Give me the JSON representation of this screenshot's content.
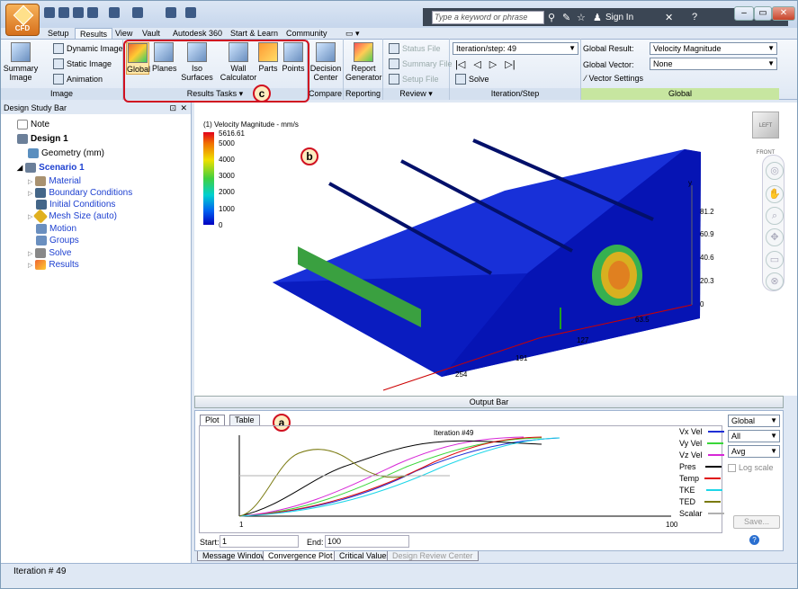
{
  "app": {
    "logo_label": "CFD"
  },
  "search": {
    "placeholder": "Type a keyword or phrase",
    "sign_in": "Sign In"
  },
  "menu_tabs": [
    "Setup",
    "Results",
    "View",
    "Vault",
    "Autodesk 360",
    "Start & Learn",
    "Community"
  ],
  "ribbon": {
    "image_group": {
      "summary_label": "Summary Image",
      "dynamic_image": "Dynamic Image",
      "static_image": "Static Image",
      "animation": "Animation",
      "group_label": "Image"
    },
    "results_tasks": {
      "global": "Global",
      "planes": "Planes",
      "iso_surfaces": "Iso Surfaces",
      "wall_calculator": "Wall Calculator",
      "parts": "Parts",
      "points": "Points",
      "group_label": "Results Tasks"
    },
    "compare": {
      "decision_center": "Decision Center",
      "group_label": "Compare"
    },
    "reporting": {
      "report_generator": "Report Generator",
      "group_label": "Reporting"
    },
    "review": {
      "status_file": "Status File",
      "summary_file": "Summary File",
      "setup_file": "Setup File",
      "group_label": "Review"
    },
    "iteration": {
      "dropdown_value": "Iteration/step: 49",
      "solve": "Solve",
      "group_label": "Iteration/Step"
    },
    "global": {
      "result_label": "Global Result:",
      "result_value": "Velocity Magnitude",
      "vector_label": "Global Vector:",
      "vector_value": "None",
      "vector_settings": "Vector Settings",
      "group_label": "Global"
    }
  },
  "callouts": {
    "a": "a",
    "b": "b",
    "c": "c"
  },
  "design_study_bar": {
    "title": "Design Study Bar",
    "items": [
      {
        "label": "Note"
      },
      {
        "label": "Design 1"
      },
      {
        "label": "Geometry (mm)"
      },
      {
        "label": "Scenario 1"
      },
      {
        "label": "Material"
      },
      {
        "label": "Boundary Conditions"
      },
      {
        "label": "Initial Conditions"
      },
      {
        "label": "Mesh Size (auto)"
      },
      {
        "label": "Motion"
      },
      {
        "label": "Groups"
      },
      {
        "label": "Solve"
      },
      {
        "label": "Results"
      }
    ]
  },
  "viewport": {
    "legend_title": "(1) Velocity Magnitude - mm/s",
    "legend_values": [
      "5616.61",
      "5000",
      "4000",
      "3000",
      "2000",
      "1000",
      "0"
    ],
    "y_axis_label": "y",
    "y_ticks": [
      "81.2",
      "60.9",
      "40.6",
      "20.3",
      "0"
    ],
    "depth_ticks": [
      "127",
      "63.5"
    ],
    "width_ticks": [
      "254",
      "191"
    ],
    "viewcube_label": "LEFT FRONT"
  },
  "output_bar": {
    "title": "Output Bar"
  },
  "plot": {
    "tabs": [
      "Plot",
      "Table"
    ],
    "title": "Iteration #49",
    "x_start_label": "1",
    "x_end_label": "100",
    "start_label": "Start:",
    "start_value": "1",
    "end_label": "End:",
    "end_value": "100",
    "legend": [
      {
        "name": "Vx Vel",
        "color": "#1f2fd6"
      },
      {
        "name": "Vy Vel",
        "color": "#39d639"
      },
      {
        "name": "Vz Vel",
        "color": "#d627d6"
      },
      {
        "name": "Pres",
        "color": "#000000"
      },
      {
        "name": "Temp",
        "color": "#e01010"
      },
      {
        "name": "TKE",
        "color": "#1ed6e8"
      },
      {
        "name": "TED",
        "color": "#7a7a10"
      },
      {
        "name": "Scalar",
        "color": "#b0b0b0"
      }
    ],
    "scope_value": "Global",
    "filter_value": "All",
    "stat_value": "Avg",
    "log_scale_label": "Log scale",
    "save_label": "Save..."
  },
  "bottom_tabs": [
    "Message Window",
    "Convergence Plot",
    "Critical Values",
    "Design Review Center"
  ],
  "status": {
    "text": "Iteration # 49"
  }
}
